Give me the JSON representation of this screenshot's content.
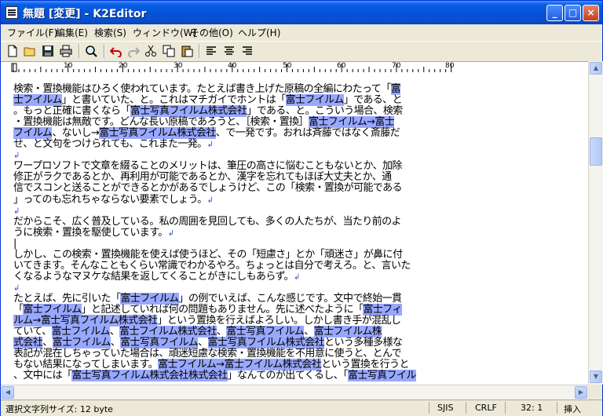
{
  "window": {
    "title": "無題 [変更] - K2Editor",
    "minimize_label": "_",
    "maximize_label": "□",
    "close_label": "×"
  },
  "menu": [
    "ファイル(F)",
    "編集(E)",
    "検索(S)",
    "ウィンドウ(W)",
    "その他(O)",
    "ヘルプ(H)"
  ],
  "toolbar": {
    "icons": [
      "new-file-icon",
      "open-folder-icon",
      "save-icon",
      "print-icon",
      "find-icon",
      "undo-icon",
      "redo-icon",
      "cut-icon",
      "copy-icon",
      "paste-icon",
      "align-left-icon",
      "align-center-icon",
      "align-right-icon"
    ]
  },
  "ruler": {
    "marks": [
      "10",
      "20",
      "30",
      "40",
      "50",
      "60",
      "70",
      "80"
    ]
  },
  "editor": {
    "lines": [
      {
        "segments": [
          {
            "t": "検索・置換機能はひろく使われています。たとえば書き上げた原稿の全編にわたって「"
          },
          {
            "t": "富",
            "h": 1
          }
        ]
      },
      {
        "segments": [
          {
            "t": "士フイルム",
            "h": 1
          },
          {
            "t": "」と書いていた、と。これはマチガイでホントは「"
          },
          {
            "t": "富士フイルム",
            "h": 1
          },
          {
            "t": "」である、と"
          }
        ]
      },
      {
        "segments": [
          {
            "t": "。もっと正確に書くなら「"
          },
          {
            "t": "富士写真フイルム株式会社",
            "h": 1
          },
          {
            "t": "」である、と。こういう場合、検索"
          }
        ]
      },
      {
        "segments": [
          {
            "t": "・置換機能は無敵です。どんな長い原稿であろうと、［検索・置換］"
          },
          {
            "t": "富士フイルム→富士",
            "h": 1
          }
        ]
      },
      {
        "segments": [
          {
            "t": "フイルム",
            "h": 1
          },
          {
            "t": "、ないし→"
          },
          {
            "t": "富士写真フイルム株式会社",
            "h": 1
          },
          {
            "t": "、で一発です。おれは斉藤ではなく斎藤だ"
          }
        ]
      },
      {
        "segments": [
          {
            "t": "せ、と文句をつけられても、これまた一発。"
          }
        ],
        "ret": 1
      },
      {
        "segments": [],
        "ret": 1
      },
      {
        "segments": [
          {
            "t": "ワープロソフトで文章を綴ることのメリットは、筆圧の高さに悩むこともないとか、加除"
          }
        ]
      },
      {
        "segments": [
          {
            "t": "修正がラクであるとか、再利用が可能であるとか、漢字を忘れてもほぼ大丈夫とか、通"
          }
        ]
      },
      {
        "segments": [
          {
            "t": "信でスコンと送ることができるとかがあるでしょうけど、この「検索・置換が可能である"
          }
        ]
      },
      {
        "segments": [
          {
            "t": "」ってのも忘れちゃならない要素でしょう。"
          }
        ],
        "ret": 1
      },
      {
        "segments": [],
        "ret": 1
      },
      {
        "segments": [
          {
            "t": "だからこそ、広く普及している。私の周囲を見回しても、多くの人たちが、当たり前のよ"
          }
        ]
      },
      {
        "segments": [
          {
            "t": "うに検索・置換を駆使しています。"
          }
        ],
        "ret": 1
      },
      {
        "segments": [
          {
            "t": "|"
          }
        ]
      },
      {
        "segments": [
          {
            "t": "しかし、この検索・置換機能を使えば使うほど、その「短慮さ」とか「頑迷さ」が鼻に付"
          }
        ]
      },
      {
        "segments": [
          {
            "t": "いてきます。そんなこともくらい常識でわかるやろ。ちょっとは自分で考えろ。と、言いた"
          }
        ]
      },
      {
        "segments": [
          {
            "t": "くなるようなマヌケな結果を返してくることがきにしもあらず。"
          }
        ],
        "ret": 1
      },
      {
        "segments": [],
        "ret": 1
      },
      {
        "segments": [
          {
            "t": "たとえば、先に引いた「"
          },
          {
            "t": "富士フイルム",
            "h": 1
          },
          {
            "t": "」の例でいえば、こんな感じです。文中で終始一貫"
          }
        ]
      },
      {
        "segments": [
          {
            "t": "「"
          },
          {
            "t": "富士フイルム",
            "h": 1
          },
          {
            "t": "」と記述していれば何の問題もありません。先に述べたように「"
          },
          {
            "t": "富士フィ",
            "h": 1
          }
        ]
      },
      {
        "segments": [
          {
            "t": "ルム→富士写真フイルム株式会社",
            "h": 1
          },
          {
            "t": "」という置換を行えばよろしい。しかし書き手が混乱し"
          }
        ]
      },
      {
        "segments": [
          {
            "t": "ていて、"
          },
          {
            "t": "富士フイルム",
            "h": 1
          },
          {
            "t": "、"
          },
          {
            "t": "富士フイルム株式会社",
            "h": 1
          },
          {
            "t": "、"
          },
          {
            "t": "富士写真フイルム",
            "h": 1
          },
          {
            "t": "、"
          },
          {
            "t": "富士フイルム株",
            "h": 1
          }
        ]
      },
      {
        "segments": [
          {
            "t": "式会社",
            "h": 1
          },
          {
            "t": "、"
          },
          {
            "t": "富士フイルム",
            "h": 1
          },
          {
            "t": "、"
          },
          {
            "t": "富士写真フイルム",
            "h": 1
          },
          {
            "t": "、"
          },
          {
            "t": "富士写真フイルム株式会社",
            "h": 1
          },
          {
            "t": "という多種多様な"
          }
        ]
      },
      {
        "segments": [
          {
            "t": "表記が混在しちゃっていた場合は、頑迷短慮な検索・置換機能を不用意に使うと、とんで"
          }
        ]
      },
      {
        "segments": [
          {
            "t": "もない結果になってしまいます。"
          },
          {
            "t": "富士フイルム→富士フイルム株式会社",
            "h": 1
          },
          {
            "t": "という置換を行うと"
          }
        ]
      },
      {
        "segments": [
          {
            "t": "、文中には「"
          },
          {
            "t": "富士写真フイルム株式会社株式会社",
            "h": 1
          },
          {
            "t": "」なんてのが出てくるし、「"
          },
          {
            "t": "富士写真フイル",
            "h": 1
          }
        ]
      }
    ]
  },
  "status": {
    "selection": "選択文字列サイズ: 12 byte",
    "encoding": "SJIS",
    "line_ending": "CRLF",
    "position": "32:  1",
    "mode": "挿入"
  }
}
